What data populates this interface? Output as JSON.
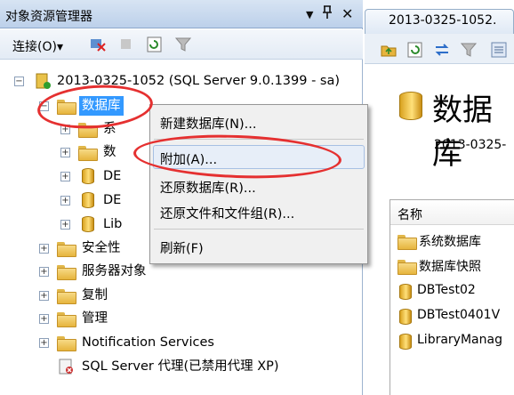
{
  "panel": {
    "title": "对象资源管理器",
    "pin_glyph": "▼",
    "dock_glyph": "ᚹ",
    "close_glyph": "✕"
  },
  "toolbar": {
    "connect_label": "连接(O)▾"
  },
  "tree": {
    "server": "2013-0325-1052 (SQL Server 9.0.1399 - sa)",
    "databases": "数据库",
    "sub_system_partial": "系",
    "sub_snapshot_partial": "数",
    "sub_db1_partial": "DE",
    "sub_db2_partial": "DE",
    "sub_lib_partial": "Lib",
    "security": "安全性",
    "server_objects": "服务器对象",
    "replication": "复制",
    "management": "管理",
    "notification": "Notification Services",
    "agent": "SQL Server 代理(已禁用代理 XP)"
  },
  "context_menu": {
    "new_database": "新建数据库(N)...",
    "attach": "附加(A)...",
    "restore_database": "还原数据库(R)...",
    "restore_files": "还原文件和文件组(R)...",
    "refresh": "刷新(F)"
  },
  "doc": {
    "tab_title": "2013-0325-1052.",
    "big_title": "数据库",
    "server_name": "2013-0325-",
    "column_header": "名称",
    "items": [
      "系统数据库",
      "数据库快照",
      "DBTest02",
      "DBTest0401V",
      "LibraryManag"
    ]
  },
  "colors": {
    "highlight": "#3399ff",
    "annotation_ring": "#e53030"
  }
}
